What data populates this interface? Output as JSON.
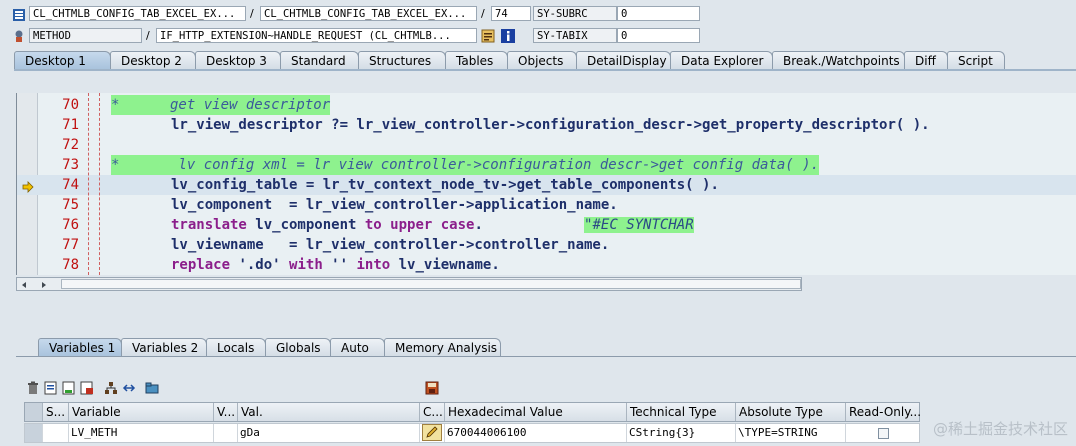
{
  "header": {
    "row1": {
      "program": "CL_CHTMLB_CONFIG_TAB_EXCEL_EX...",
      "include": "CL_CHTMLB_CONFIG_TAB_EXCEL_EX...",
      "line": "74",
      "sysvar_name": "SY-SUBRC",
      "sysvar_value": "0"
    },
    "row2": {
      "event_type": "METHOD",
      "event": "IF_HTTP_EXTENSION~HANDLE_REQUEST (CL_CHTMLB...",
      "sysvar_name": "SY-TABIX",
      "sysvar_value": "0"
    },
    "separator": "/"
  },
  "tabs": [
    "Desktop 1",
    "Desktop 2",
    "Desktop 3",
    "Standard",
    "Structures",
    "Tables",
    "Objects",
    "DetailDisplay",
    "Data Explorer",
    "Break./Watchpoints",
    "Diff",
    "Script"
  ],
  "code": {
    "lines": [
      {
        "n": "70"
      },
      {
        "n": "71"
      },
      {
        "n": "72"
      },
      {
        "n": "73"
      },
      {
        "n": "74"
      },
      {
        "n": "75"
      },
      {
        "n": "76"
      },
      {
        "n": "77"
      },
      {
        "n": "78"
      }
    ],
    "l70": "*      get view descriptor",
    "l71": "lr_view_descriptor ?= lr_view_controller->configuration_descr->get_property_descriptor( ).",
    "l73": "*       lv config xml = lr view controller->configuration descr->get config data( ).",
    "l74": "lv_config_table = lr_tv_context_node_tv->get_table_components( ).",
    "l75": "lv_component  = lr_view_controller->application_name.",
    "l76_kw1": "translate",
    "l76_mid": " lv_component ",
    "l76_kw2": "to upper case",
    "l76_end": ".",
    "l76_pad": "            ",
    "l76_comment": "\"#EC SYNTCHAR",
    "l77": "lv_viewname   = lr_view_controller->controller_name.",
    "l78_kw1": "replace",
    "l78_s1": " '.do' ",
    "l78_kw2": "with",
    "l78_s2": " '' ",
    "l78_kw3": "into",
    "l78_end": " lv_viewname."
  },
  "lower_tabs": [
    "Variables 1",
    "Variables 2",
    "Locals",
    "Globals",
    "Auto",
    "Memory Analysis"
  ],
  "table": {
    "headers": [
      "S...",
      "Variable",
      "V...",
      "Val.",
      "C...",
      "Hexadecimal Value",
      "Technical Type",
      "Absolute Type",
      "Read-Only..."
    ],
    "rows": [
      {
        "variable": "LV_METH",
        "value": "gDa",
        "hex": "670044006100",
        "technical_type": "CString{3}",
        "absolute_type": "\\TYPE=STRING"
      }
    ]
  },
  "watermark": "@稀土掘金技术社区"
}
